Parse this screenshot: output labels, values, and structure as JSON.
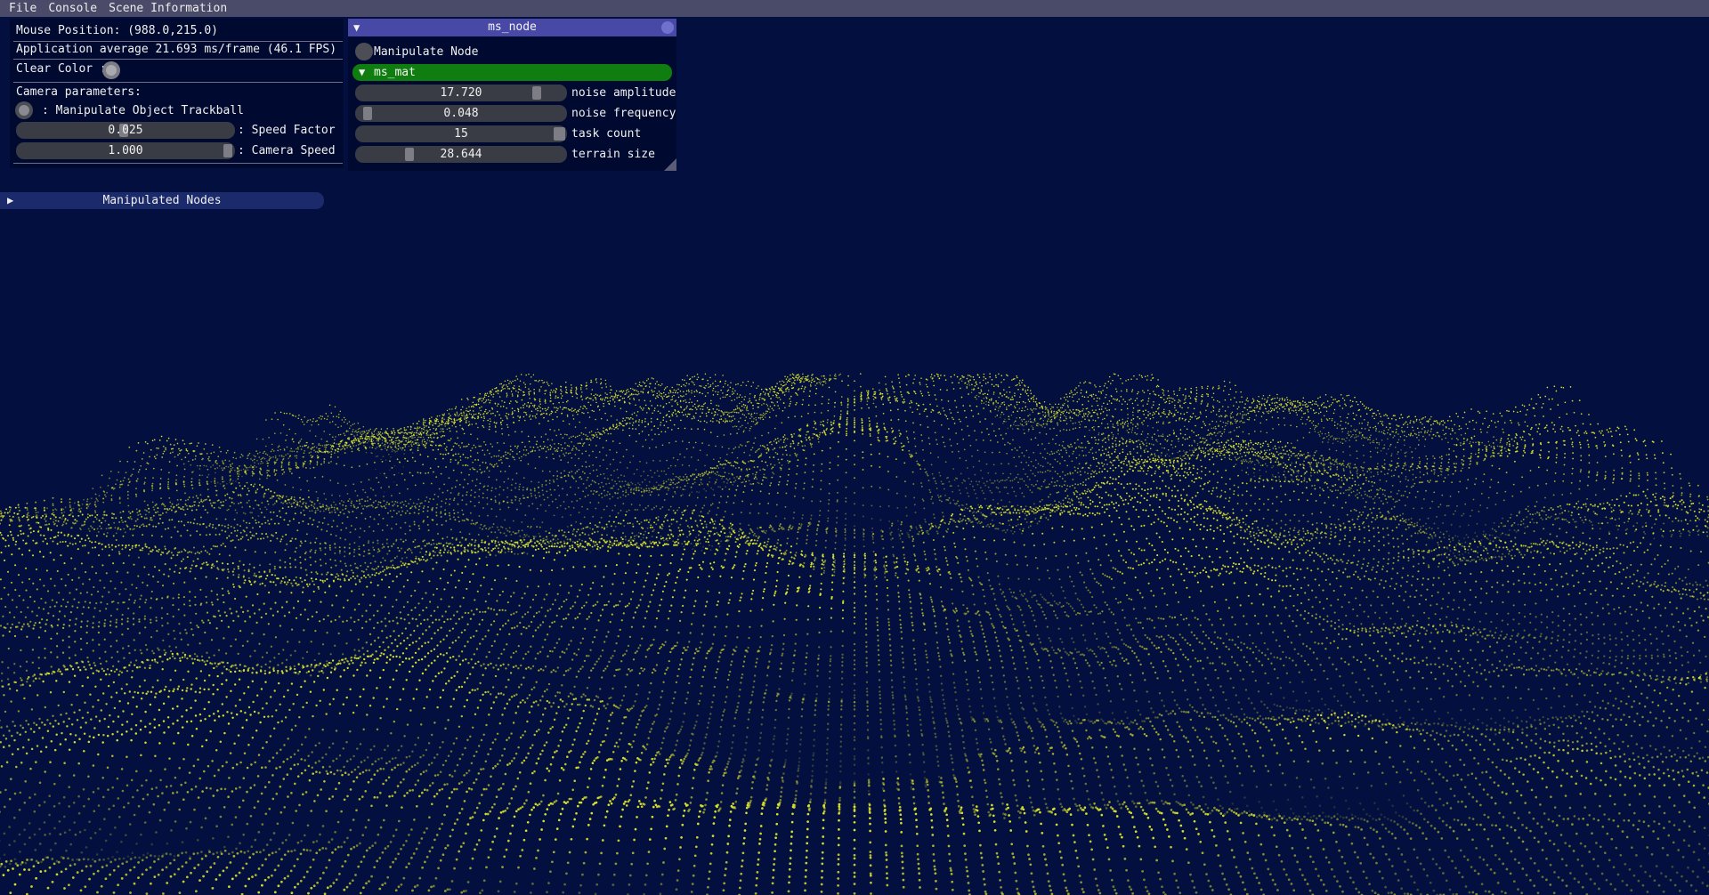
{
  "menu": {
    "items": [
      {
        "label": "File"
      },
      {
        "label": "Console"
      },
      {
        "label": "Scene Information"
      }
    ]
  },
  "info_panel": {
    "mouse_position": "Mouse Position: (988.0,215.0)",
    "app_average": "Application average 21.693 ms/frame (46.1 FPS)",
    "clear_color_label": "Clear Color :",
    "camera_params_label": "Camera parameters:",
    "trackball_label": ": Manipulate Object Trackball",
    "speed_factor": {
      "value": "0.025",
      "label": ": Speed Factor",
      "fraction": 0.49
    },
    "camera_speed": {
      "value": "1.000",
      "label": ": Camera Speed",
      "fraction": 1.0
    }
  },
  "node_window": {
    "title": "ms_node",
    "manipulate_label": "Manipulate Node",
    "material_header": "ms_mat",
    "params": [
      {
        "value": "17.720",
        "label": "noise amplitude",
        "fraction": 0.87
      },
      {
        "value": "0.048",
        "label": "noise frequency",
        "fraction": 0.04
      },
      {
        "value": "15",
        "label": "task count",
        "fraction": 1.0
      },
      {
        "value": "28.644",
        "label": "terrain size",
        "fraction": 0.24
      }
    ]
  },
  "manipulated_nodes": {
    "label": "Manipulated Nodes"
  },
  "colors": {
    "background": "#03103f",
    "terrain_points": "#d7e02a",
    "menubar": "#4a4b69",
    "window_title": "#4849a6",
    "material_header": "#0f7d0f"
  },
  "icons": {
    "collapse": "triangle-down-icon",
    "expand": "triangle-right-icon",
    "close": "close-circle-icon",
    "resize": "resize-grip-icon"
  }
}
